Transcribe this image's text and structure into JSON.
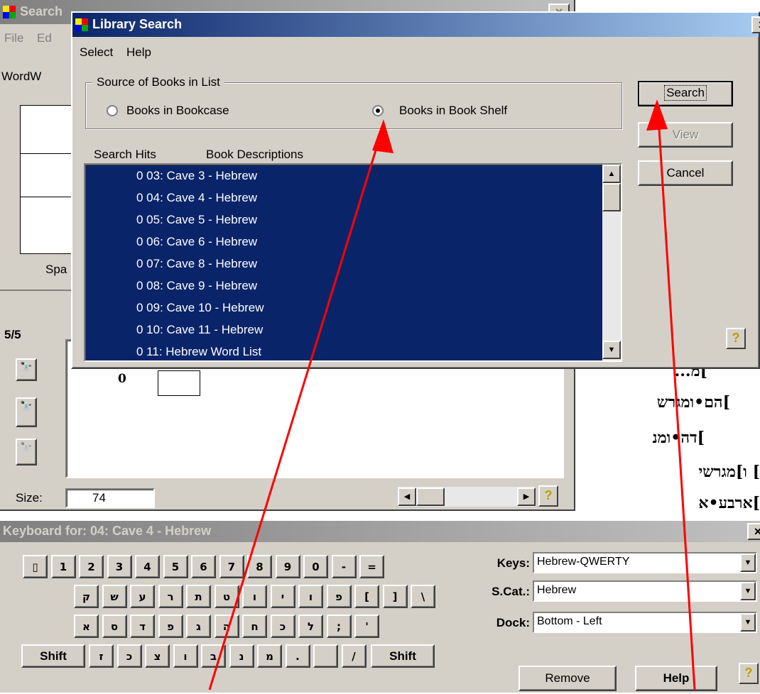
{
  "background_window": {
    "title": "Search",
    "menu": [
      "File",
      "Ed"
    ],
    "label_top": "WordW",
    "label_spa": "Spa",
    "count": "5/5",
    "zero": "0",
    "size_label": "Size:",
    "size_value": "74"
  },
  "library_search": {
    "title": "Library Search",
    "menu": [
      "Select",
      "Help"
    ],
    "group_label": "Source of Books in List",
    "radio_bookcase": "Books in Bookcase",
    "radio_bookshelf": "Books in Book Shelf",
    "selected_source": "Books in Book Shelf",
    "col_hits": "Search Hits",
    "col_desc": "Book Descriptions",
    "items": [
      "0 03: Cave 3 - Hebrew",
      "0 04: Cave 4 - Hebrew",
      "0 05: Cave 5 - Hebrew",
      "0 06: Cave 6 - Hebrew",
      "0 07: Cave 8 - Hebrew",
      "0 08: Cave 9 - Hebrew",
      "0 09: Cave 10 - Hebrew",
      "0 10: Cave 11 - Hebrew",
      "0 11: Hebrew Word List"
    ],
    "buttons": {
      "search": "Search",
      "view": "View",
      "cancel": "Cancel",
      "help": "?"
    },
    "close": "×"
  },
  "hebrew_text": [
    "]מ...",
    "]הם•ומגרש",
    "]דה•ומנ",
    "]  ו]מגרשי",
    "]ארבע•א"
  ],
  "keyboard": {
    "title": "Keyboard for: 04: Cave 4 - Hebrew",
    "close": "×",
    "row1": [
      "▯",
      "1",
      "2",
      "3",
      "4",
      "5",
      "6",
      "7",
      "8",
      "9",
      "0",
      "-",
      "="
    ],
    "row2": [
      "ק",
      "ש",
      "ע",
      "ר",
      "ת",
      "ט",
      "ו",
      "י",
      "ו",
      "פ",
      "[",
      "]",
      "\\"
    ],
    "row3": [
      "א",
      "ס",
      "ד",
      "פ",
      "ג",
      "ה",
      "ח",
      "כ",
      "ל",
      ";",
      "'"
    ],
    "row4_shift": "Shift",
    "row4": [
      "ז",
      "כ",
      "צ",
      "ו",
      "ב",
      "נ",
      "מ",
      ".",
      "",
      "/"
    ],
    "keys_label": "Keys:",
    "keys_value": "Hebrew-QWERTY",
    "scat_label": "S.Cat.:",
    "scat_value": "Hebrew",
    "dock_label": "Dock:",
    "dock_value": "Bottom - Left",
    "remove": "Remove",
    "help": "Help",
    "help_q": "?"
  },
  "colors": {
    "titlebar": "#0a246a",
    "selection": "#0a246a",
    "arrow": "#ff0000",
    "face": "#d4d0c8"
  }
}
